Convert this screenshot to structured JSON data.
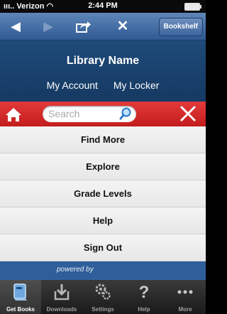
{
  "status_bar": {
    "carrier": "Verizon",
    "time": "2:44 PM"
  },
  "toolbar": {
    "bookshelf_label": "Bookshelf"
  },
  "library": {
    "name": "Library Name",
    "links": [
      "My Account",
      "My Locker"
    ]
  },
  "search": {
    "placeholder": "Search"
  },
  "menu": {
    "items": [
      "Find More",
      "Explore",
      "Grade Levels",
      "Help",
      "Sign Out"
    ]
  },
  "footer": {
    "powered_by": "powered by"
  },
  "tabs": [
    {
      "label": "Get Books",
      "icon": "get-books-icon",
      "active": true
    },
    {
      "label": "Downloads",
      "icon": "downloads-icon",
      "active": false
    },
    {
      "label": "Settings",
      "icon": "settings-icon",
      "active": false
    },
    {
      "label": "Help",
      "icon": "help-icon",
      "active": false
    },
    {
      "label": "More",
      "icon": "more-icon",
      "active": false
    }
  ],
  "colors": {
    "nav_blue": "#2f5a93",
    "library_blue": "#1f4a79",
    "search_red": "#d22b2b",
    "tab_dark": "#1a1a1a"
  }
}
